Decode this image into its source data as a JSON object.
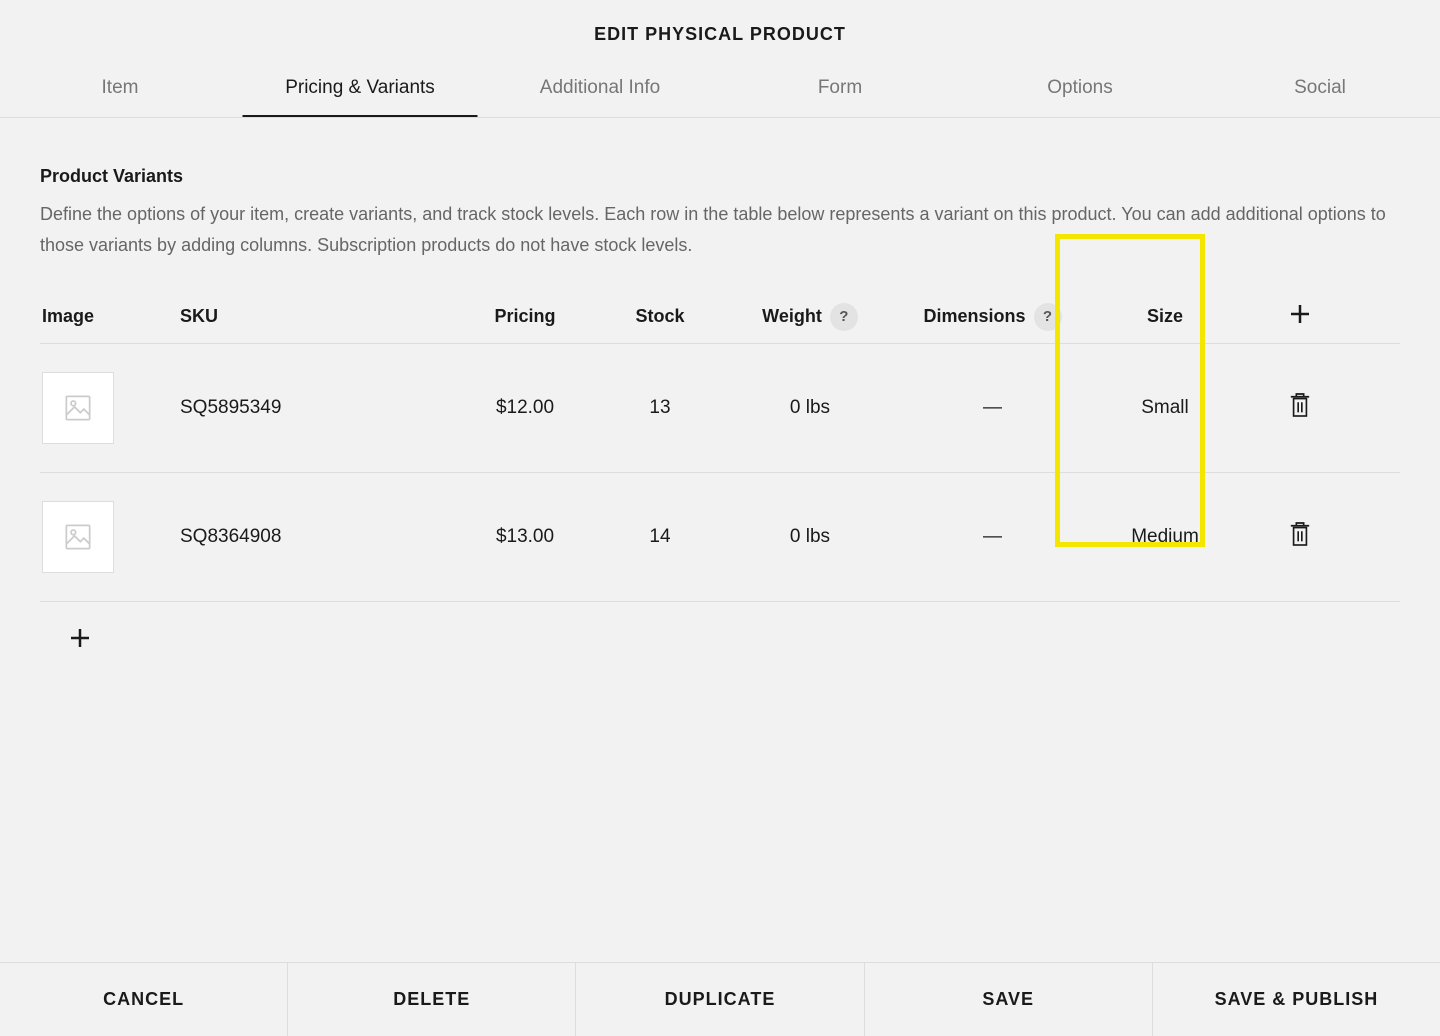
{
  "header": {
    "title": "EDIT PHYSICAL PRODUCT"
  },
  "tabs": {
    "items": [
      {
        "label": "Item"
      },
      {
        "label": "Pricing & Variants"
      },
      {
        "label": "Additional Info"
      },
      {
        "label": "Form"
      },
      {
        "label": "Options"
      },
      {
        "label": "Social"
      }
    ]
  },
  "section": {
    "title": "Product Variants",
    "description": "Define the options of your item, create variants, and track stock levels. Each row in the table below represents a variant on this product. You can add additional options to those variants by adding columns. Subscription products do not have stock levels."
  },
  "table": {
    "headers": {
      "image": "Image",
      "sku": "SKU",
      "pricing": "Pricing",
      "stock": "Stock",
      "weight": "Weight",
      "dimensions": "Dimensions",
      "size": "Size",
      "help": "?"
    },
    "rows": [
      {
        "sku": "SQ5895349",
        "pricing": "$12.00",
        "stock": "13",
        "weight": "0 lbs",
        "dimensions": "—",
        "size": "Small"
      },
      {
        "sku": "SQ8364908",
        "pricing": "$13.00",
        "stock": "14",
        "weight": "0 lbs",
        "dimensions": "—",
        "size": "Medium"
      }
    ]
  },
  "footer": {
    "cancel": "CANCEL",
    "delete": "DELETE",
    "duplicate": "DUPLICATE",
    "save": "SAVE",
    "save_publish": "SAVE & PUBLISH"
  }
}
